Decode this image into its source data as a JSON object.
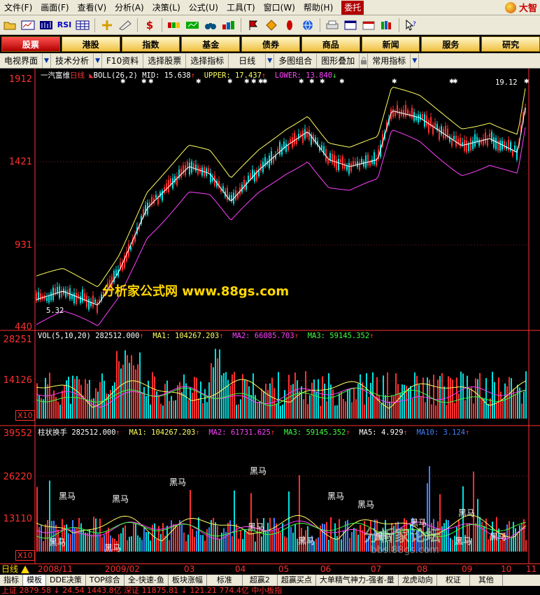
{
  "menu": {
    "items": [
      "文件(F)",
      "画面(F)",
      "查看(V)",
      "分析(A)",
      "决策(L)",
      "公式(U)",
      "工具(T)",
      "窗口(W)",
      "帮助(H)"
    ],
    "entrust": "委托",
    "logo_text": "大智"
  },
  "toolbar": {
    "rsi_label": "RSI"
  },
  "categories": [
    "股票",
    "港股",
    "指数",
    "基金",
    "债券",
    "商品",
    "新闻",
    "服务",
    "研究"
  ],
  "funcbar": [
    "电视界面",
    "技术分析",
    "F10资料",
    "选择股票",
    "选择指标",
    "日线",
    "多图组合",
    "图形叠加",
    "常用指标"
  ],
  "chart": {
    "stock_name": "一汽富维",
    "period": "日线",
    "boll": {
      "label": "BOLL(26,2)",
      "mid": "MID: 15.638",
      "upper": "UPPER: 17.437",
      "lower": "LOWER: 13.840"
    },
    "high_mark": "19.12",
    "low_mark": "5.32",
    "price_axis": [
      "1912",
      "1421",
      "931",
      "440"
    ],
    "vol_legend": {
      "label": "VOL(5,10,20)",
      "value": "282512.000",
      "ma1": "MA1: 104267.203",
      "ma2": "MA2: 66085.703",
      "ma3": "MA3: 59145.352"
    },
    "vol_axis": [
      "28251",
      "14126"
    ],
    "turn_legend": {
      "label": "柱状换手",
      "value": "282512.000",
      "ma1": "MA1: 104267.203",
      "ma2": "MA2: 61731.625",
      "ma3": "MA3: 59145.352",
      "ma5": "MA5: 4.929",
      "ma10": "MA10: 3.124"
    },
    "turn_axis": [
      "39552",
      "26220",
      "13110"
    ],
    "x10_label": "X10",
    "heima": "黑马",
    "watermark": "分析家公式网 www.88gs.com",
    "watermark2": "分析家论坛",
    "watermark3": "bbs.88gs.com"
  },
  "dates": {
    "period": "日线",
    "labels": [
      "2008/11",
      "2009/02",
      "03",
      "04",
      "05",
      "06",
      "07",
      "08",
      "09",
      "10",
      "11"
    ]
  },
  "tabs": [
    "指标",
    "模板",
    "DDE决策",
    "TOP综合",
    "全-快速-鱼",
    "板块涨幅",
    "标准",
    "超赢2",
    "超赢买点",
    "大单精气神力-强者-量",
    "龙虎动向",
    "权证",
    "其他"
  ],
  "ticker": "上证 2879.58 ↓ 24.54  1443.8亿 深证 11875.81 ↓ 121.21  774.4亿 中小板指",
  "colors": {
    "up": "#ff3030",
    "down": "#00e0e0",
    "upper": "#ffff60",
    "mid": "#ffffff",
    "lower": "#ff40ff",
    "ma_green": "#40ff40",
    "ma_blue": "#4080ff"
  }
}
